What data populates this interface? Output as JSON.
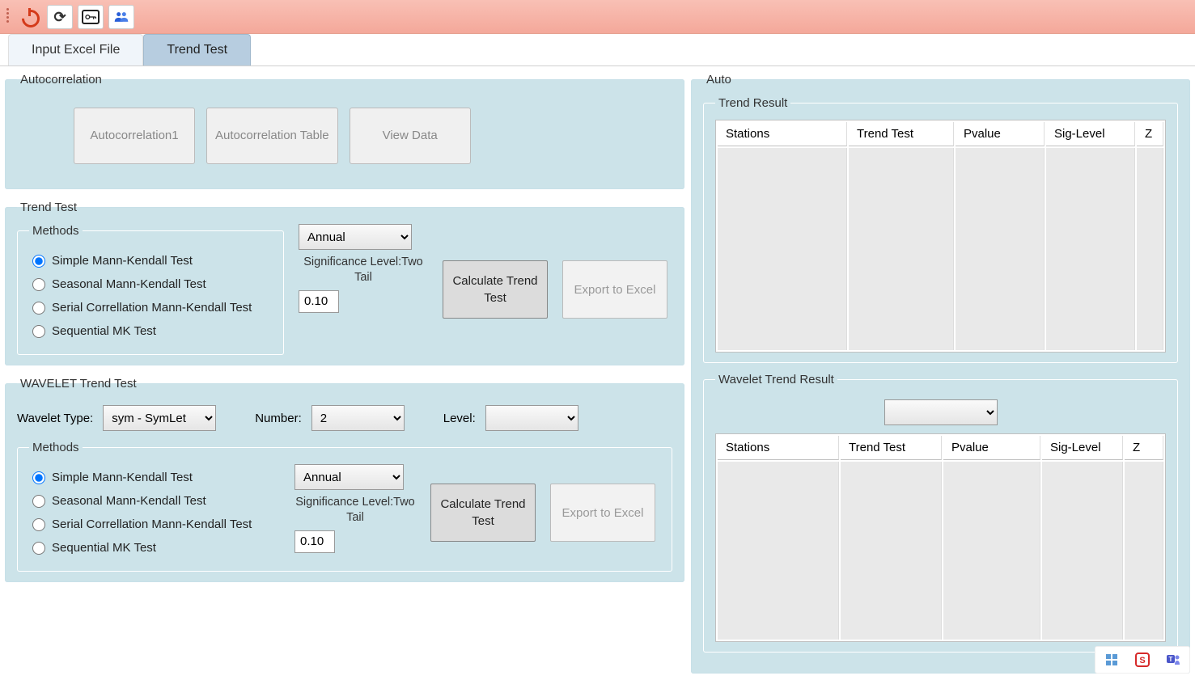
{
  "toolbar": {
    "icons": [
      "power-icon",
      "refresh-icon",
      "key-icon",
      "team-icon"
    ]
  },
  "tabs": [
    {
      "label": "Input Excel File",
      "active": false
    },
    {
      "label": "Trend Test",
      "active": true
    }
  ],
  "autocorrelation": {
    "legend": "Autocorrelation",
    "buttons": {
      "autocorr1": "Autocorrelation1",
      "autocorr_table": "Autocorrelation Table",
      "view_data": "View Data"
    }
  },
  "trend_test": {
    "legend": "Trend Test",
    "methods_legend": "Methods",
    "methods": {
      "simple": "Simple Mann-Kendall Test",
      "seasonal": "Seasonal Mann-Kendall Test",
      "serial": "Serial Correllation Mann-Kendall Test",
      "sequential": "Sequential MK Test"
    },
    "selected_method": "simple",
    "period_select": "Annual",
    "sig_label": "Significance Level:Two Tail",
    "sig_value": "0.10",
    "calc_btn": "Calculate Trend Test",
    "export_btn": "Export to Excel"
  },
  "wavelet_test": {
    "legend": "WAVELET Trend Test",
    "wavelet_type_label": "Wavelet Type:",
    "wavelet_type": "sym - SymLet",
    "number_label": "Number:",
    "number": "2",
    "level_label": "Level:",
    "level": "",
    "methods_legend": "Methods",
    "methods": {
      "simple": "Simple Mann-Kendall Test",
      "seasonal": "Seasonal Mann-Kendall Test",
      "serial": "Serial Correllation Mann-Kendall Test",
      "sequential": "Sequential MK Test"
    },
    "selected_method": "simple",
    "period_select": "Annual",
    "sig_label": "Significance Level:Two Tail",
    "sig_value": "0.10",
    "calc_btn": "Calculate Trend Test",
    "export_btn": "Export to Excel"
  },
  "auto": {
    "legend": "Auto",
    "trend_result_legend": "Trend Result",
    "wavelet_result_legend": "Wavelet Trend Result",
    "columns": [
      "Stations",
      "Trend Test",
      "Pvalue",
      "Sig-Level",
      "Z"
    ]
  }
}
